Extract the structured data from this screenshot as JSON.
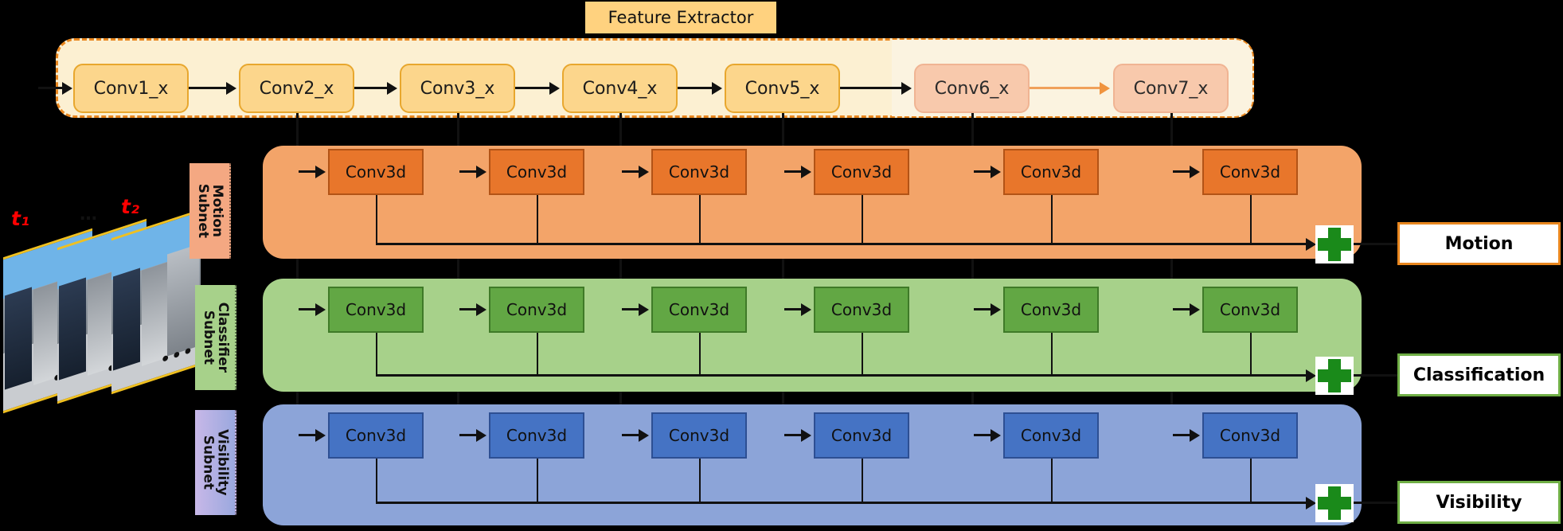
{
  "feature_extractor": {
    "badge_label": "Feature Extractor",
    "blocks": [
      {
        "label": "Conv1_x",
        "faded": false
      },
      {
        "label": "Conv2_x",
        "faded": false
      },
      {
        "label": "Conv3_x",
        "faded": false
      },
      {
        "label": "Conv4_x",
        "faded": false
      },
      {
        "label": "Conv5_x",
        "faded": false
      },
      {
        "label": "Conv6_x",
        "faded": true
      },
      {
        "label": "Conv7_x",
        "faded": true
      }
    ]
  },
  "input": {
    "frame_label_first": "t₁",
    "frame_label_last": "t₂",
    "frame_ellipsis": "…",
    "inner_ellipsis": "•••"
  },
  "subnets": [
    {
      "id": "motion",
      "tag_line1": "Motion",
      "tag_line2": "Subnet",
      "block_label": "Conv3d",
      "block_count": 6,
      "sum_icon": "plus-icon",
      "output_label": "Motion",
      "color": "#F3A469",
      "block_color": "#E8762B",
      "output_border": "#E8861E"
    },
    {
      "id": "classifier",
      "tag_line1": "Classifier",
      "tag_line2": "Subnet",
      "block_label": "Conv3d",
      "block_count": 6,
      "sum_icon": "plus-icon",
      "output_label": "Classification",
      "color": "#A7D18A",
      "block_color": "#62A744",
      "output_border": "#6FAE45"
    },
    {
      "id": "visibility",
      "tag_line1": "Visibility",
      "tag_line2": "Subnet",
      "block_label": "Conv3d",
      "block_count": 6,
      "sum_icon": "plus-icon",
      "output_label": "Visibility",
      "color": "#8CA4D8",
      "block_color": "#4573C4",
      "output_border": "#6FAE45"
    }
  ]
}
